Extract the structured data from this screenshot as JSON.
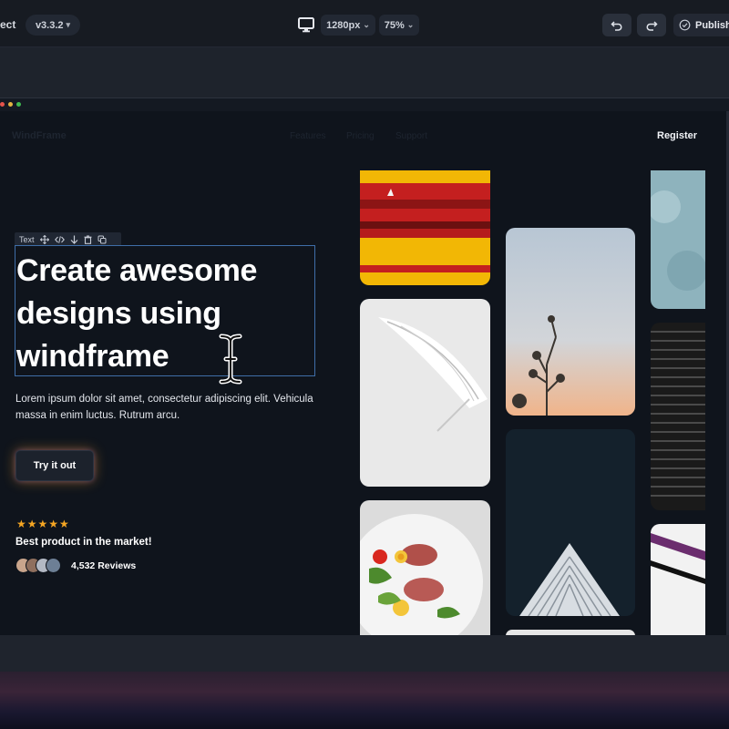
{
  "toolbar": {
    "app_name_partial": "ect",
    "version": "v3.3.2",
    "resolution": "1280px",
    "zoom": "75%",
    "publish_label": "Publish"
  },
  "preview": {
    "nav": {
      "logo": "WindFrame",
      "links": [
        "Features",
        "Pricing",
        "Support"
      ],
      "register": "Register"
    },
    "element_toolbar": {
      "label": "Text"
    },
    "headline": "Create awesome designs using windframe",
    "description": "Lorem ipsum dolor sit amet, consectetur adipiscing elit. Vehicula massa in enim luctus. Rutrum arcu.",
    "cta_label": "Try it out",
    "rating": {
      "stars": 5,
      "stars_text": "★★★★★",
      "tagline": "Best product in the market!",
      "reviews": "4,532 Reviews"
    }
  },
  "icons": [
    "caret-down-icon",
    "monitor-icon",
    "undo-icon",
    "redo-icon",
    "check-circle-icon",
    "move-icon",
    "code-icon",
    "arrow-down-icon",
    "trash-icon",
    "duplicate-icon",
    "text-cursor-icon"
  ],
  "colors": {
    "accent_select": "#3f6ea8",
    "star": "#f5a623",
    "background": "#0f141c"
  }
}
